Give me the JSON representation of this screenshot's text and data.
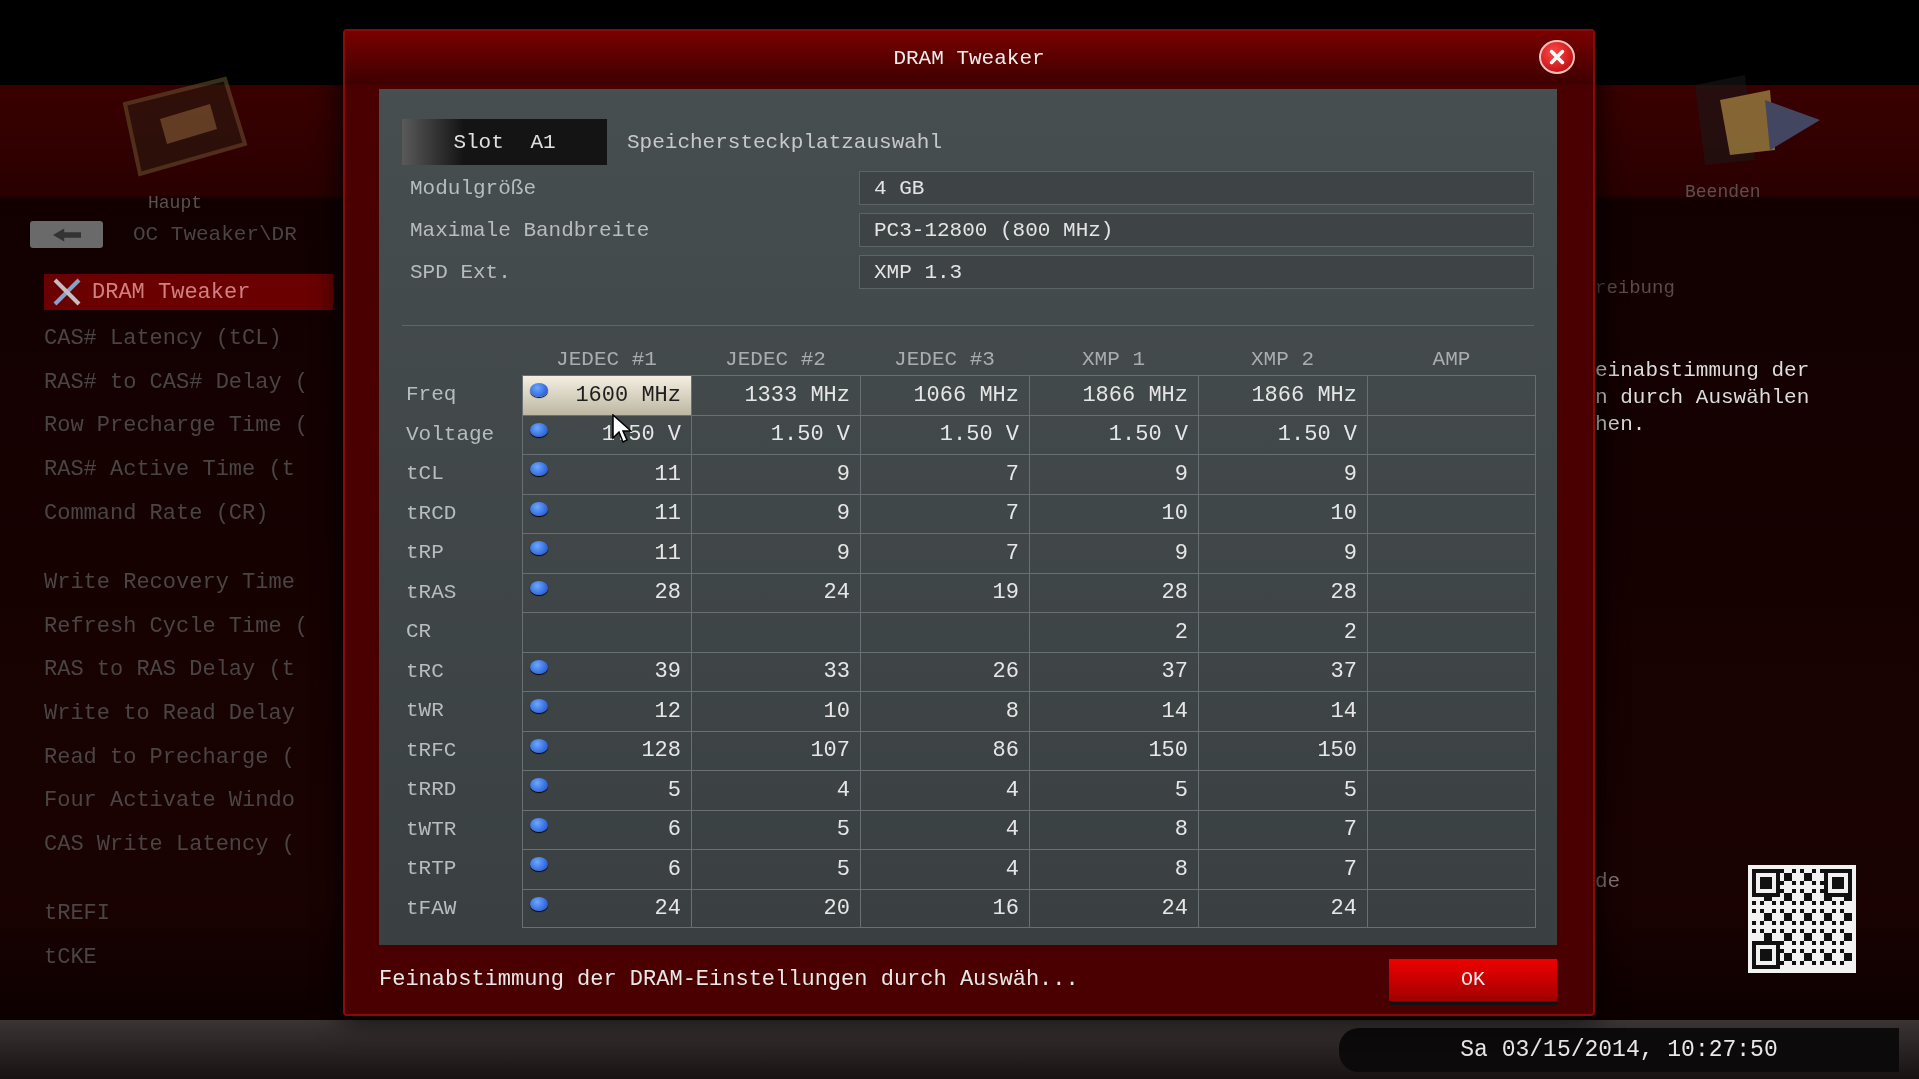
{
  "background": {
    "left_tab": {
      "label": "Haupt"
    },
    "right_tab": {
      "label": "Beenden"
    },
    "breadcrumb": "OC Tweaker\\DR",
    "menu_groups": [
      {
        "items": [
          {
            "label": "DRAM Tweaker",
            "selected": true
          },
          {
            "label": "CAS# Latency (tCL)",
            "selected": false
          },
          {
            "label": "RAS# to CAS# Delay (",
            "selected": false
          },
          {
            "label": "Row Precharge Time (",
            "selected": false
          },
          {
            "label": "RAS# Active Time (t",
            "selected": false
          },
          {
            "label": "Command Rate (CR)",
            "selected": false
          }
        ]
      },
      {
        "items": [
          {
            "label": "Write Recovery Time",
            "selected": false
          },
          {
            "label": "Refresh Cycle Time (",
            "selected": false
          },
          {
            "label": "RAS to RAS Delay (t",
            "selected": false
          },
          {
            "label": "Write to Read Delay",
            "selected": false
          },
          {
            "label": "Read to Precharge (",
            "selected": false
          },
          {
            "label": "Four Activate Windo",
            "selected": false
          },
          {
            "label": "CAS Write Latency (",
            "selected": false
          }
        ]
      },
      {
        "items": [
          {
            "label": "tREFI",
            "selected": false
          },
          {
            "label": "tCKE",
            "selected": false
          }
        ]
      }
    ],
    "description_heading": "reibung",
    "description": [
      "einabstimmung der",
      "n durch Auswählen",
      "hen."
    ],
    "side_note": "de",
    "clock": "Sa 03/15/2014, 10:27:50"
  },
  "dialog": {
    "title": "DRAM Tweaker",
    "slot_tab": "Slot A1",
    "slot_label": "Speichersteckplatzauswahl",
    "info": [
      {
        "label": "Modulgröße",
        "value": "4 GB"
      },
      {
        "label": "Maximale Bandbreite",
        "value": "PC3-12800 (800 MHz)"
      },
      {
        "label": "SPD Ext.",
        "value": "XMP 1.3"
      }
    ],
    "columns": [
      "JEDEC #1",
      "JEDEC #2",
      "JEDEC #3",
      "XMP 1",
      "XMP 2",
      "AMP"
    ],
    "rows": [
      {
        "label": "Freq",
        "radio": true,
        "highlighted": true,
        "values": [
          "1600 MHz",
          "1333 MHz",
          "1066 MHz",
          "1866 MHz",
          "1866 MHz"
        ]
      },
      {
        "label": "Voltage",
        "radio": true,
        "highlighted": false,
        "values": [
          "1.50 V",
          "1.50 V",
          "1.50 V",
          "1.50 V",
          "1.50 V"
        ]
      },
      {
        "label": "tCL",
        "radio": true,
        "highlighted": false,
        "values": [
          "11",
          "9",
          "7",
          "9",
          "9"
        ]
      },
      {
        "label": "tRCD",
        "radio": true,
        "highlighted": false,
        "values": [
          "11",
          "9",
          "7",
          "10",
          "10"
        ]
      },
      {
        "label": "tRP",
        "radio": true,
        "highlighted": false,
        "values": [
          "11",
          "9",
          "7",
          "9",
          "9"
        ]
      },
      {
        "label": "tRAS",
        "radio": true,
        "highlighted": false,
        "values": [
          "28",
          "24",
          "19",
          "28",
          "28"
        ]
      },
      {
        "label": "CR",
        "radio": false,
        "highlighted": false,
        "jedec_empty": true,
        "values": [
          "2",
          "2"
        ]
      },
      {
        "label": "tRC",
        "radio": true,
        "highlighted": false,
        "values": [
          "39",
          "33",
          "26",
          "37",
          "37"
        ]
      },
      {
        "label": "tWR",
        "radio": true,
        "highlighted": false,
        "values": [
          "12",
          "10",
          "8",
          "14",
          "14"
        ]
      },
      {
        "label": "tRFC",
        "radio": true,
        "highlighted": false,
        "values": [
          "128",
          "107",
          "86",
          "150",
          "150"
        ]
      },
      {
        "label": "tRRD",
        "radio": true,
        "highlighted": false,
        "values": [
          "5",
          "4",
          "4",
          "5",
          "5"
        ]
      },
      {
        "label": "tWTR",
        "radio": true,
        "highlighted": false,
        "values": [
          "6",
          "5",
          "4",
          "8",
          "7"
        ]
      },
      {
        "label": "tRTP",
        "radio": true,
        "highlighted": false,
        "values": [
          "6",
          "5",
          "4",
          "8",
          "7"
        ]
      },
      {
        "label": "tFAW",
        "radio": true,
        "highlighted": false,
        "values": [
          "24",
          "20",
          "16",
          "24",
          "24"
        ]
      }
    ],
    "hint": "Feinabstimmung der DRAM-Einstellungen durch Auswäh...",
    "ok": "OK"
  }
}
